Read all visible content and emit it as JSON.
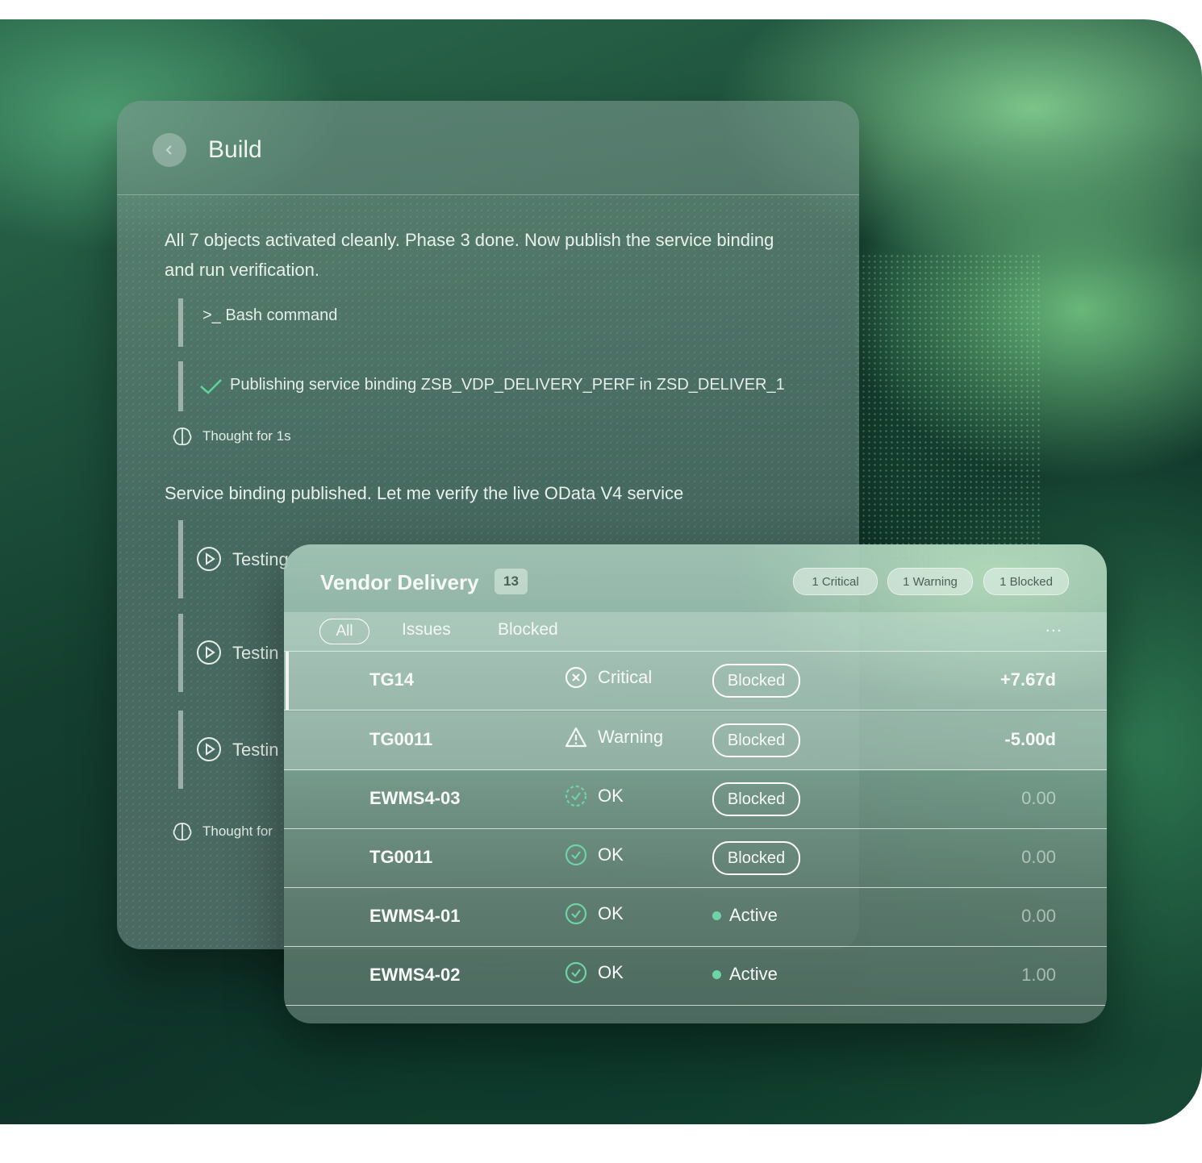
{
  "build": {
    "title": "Build",
    "message1": "All 7 objects activated cleanly. Phase 3 done. Now publish the service binding and run verification.",
    "step1": ">_ Bash command",
    "step2": "Publishing service binding ZSB_VDP_DELIVERY_PERF in ZSD_DELIVER_1",
    "thought1": "Thought for 1s",
    "message2": "Service binding published. Let me verify the live OData V4 service",
    "tests": [
      "Testing",
      "Testin",
      "Testin"
    ],
    "thought2": "Thought for"
  },
  "vendor": {
    "title": "Vendor Delivery",
    "count": "13",
    "pills": [
      "1 Critical",
      "1 Warning",
      "1 Blocked"
    ],
    "tabs": [
      "All",
      "Issues",
      "Blocked"
    ],
    "more": "...",
    "rows": [
      {
        "id": "TG14",
        "status": "Critical",
        "status_icon": "x-circle-icon",
        "state": "Blocked",
        "value": "+7.67d"
      },
      {
        "id": "TG0011",
        "status": "Warning",
        "status_icon": "warning-triangle-icon",
        "state": "Blocked",
        "value": "-5.00d"
      },
      {
        "id": "EWMS4-03",
        "status": "OK",
        "status_icon": "check-circle-icon",
        "state": "Blocked",
        "value": "0.00"
      },
      {
        "id": "TG0011",
        "status": "OK",
        "status_icon": "check-circle-icon",
        "state": "Blocked",
        "value": "0.00"
      },
      {
        "id": "EWMS4-01",
        "status": "OK",
        "status_icon": "check-circle-icon",
        "state": "Active",
        "value": "0.00"
      },
      {
        "id": "EWMS4-02",
        "status": "OK",
        "status_icon": "check-circle-icon",
        "state": "Active",
        "value": "1.00"
      }
    ]
  },
  "colors": {
    "accent_green": "#6fd3a6",
    "check_green": "#5fd39a"
  }
}
